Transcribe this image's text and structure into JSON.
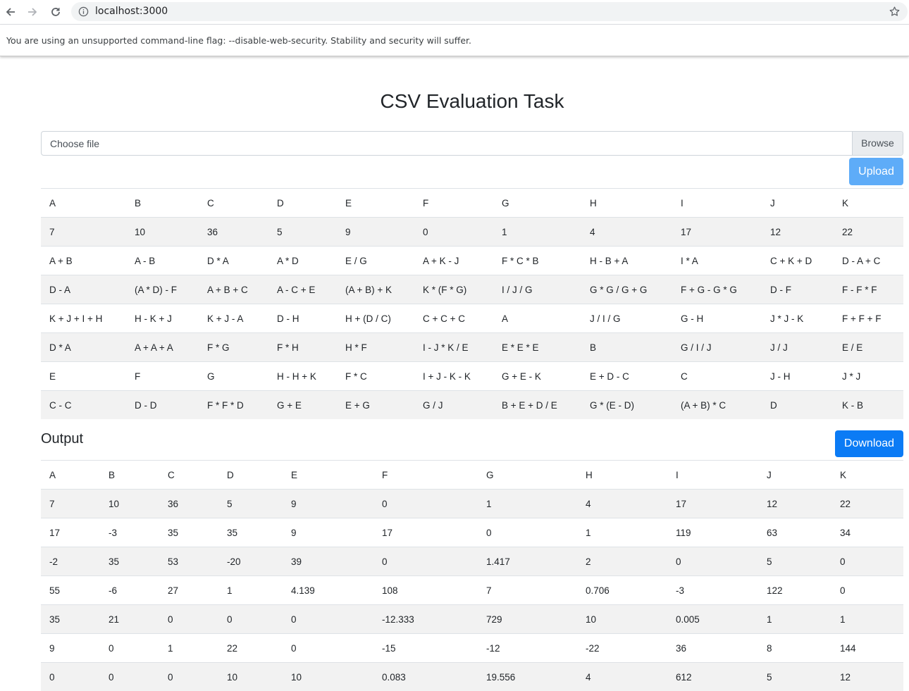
{
  "browser": {
    "url": "localhost:3000",
    "infobar": "You are using an unsupported command-line flag: --disable-web-security. Stability and security will suffer."
  },
  "page": {
    "title": "CSV Evaluation Task",
    "file_placeholder": "Choose file",
    "browse_label": "Browse",
    "upload_label": "Upload",
    "output_title": "Output",
    "download_label": "Download"
  },
  "colors": {
    "upload_button": "#5eacf8",
    "download_button": "#0b7bf5",
    "stripe": "#f2f2f2"
  },
  "input_table": {
    "rows": [
      [
        "A",
        "B",
        "C",
        "D",
        "E",
        "F",
        "G",
        "H",
        "I",
        "J",
        "K"
      ],
      [
        "7",
        "10",
        "36",
        "5",
        "9",
        "0",
        "1",
        "4",
        "17",
        "12",
        "22"
      ],
      [
        "A + B",
        "A - B",
        "D * A",
        "A * D",
        "E / G",
        "A + K - J",
        "F * C * B",
        "H - B + A",
        "I * A",
        "C + K + D",
        "D - A + C"
      ],
      [
        "D - A",
        "(A * D) - F",
        "A + B + C",
        "A - C + E",
        "(A + B) + K",
        "K * (F * G)",
        "I / J / G",
        "G * G / G + G",
        "F + G - G * G",
        "D - F",
        "F - F * F"
      ],
      [
        "K + J + I + H",
        "H - K + J",
        "K + J - A",
        "D - H",
        "H + (D / C)",
        "C + C + C",
        "A",
        "J / I / G",
        "G - H",
        "J * J - K",
        "F + F + F"
      ],
      [
        "D * A",
        "A + A + A",
        "F * G",
        "F * H",
        "H * F",
        "I - J * K / E",
        "E * E * E",
        "B",
        "G / I / J",
        "J / J",
        "E / E"
      ],
      [
        "E",
        "F",
        "G",
        "H - H + K",
        "F * C",
        "I + J - K - K",
        "G + E - K",
        "E + D - C",
        "C",
        "J - H",
        "J * J"
      ],
      [
        "C - C",
        "D - D",
        "F * F * D",
        "G + E",
        "E + G",
        "G / J",
        "B + E + D / E",
        "G * (E - D)",
        "(A + B) * C",
        "D",
        "K - B"
      ]
    ]
  },
  "output_table": {
    "rows": [
      [
        "A",
        "B",
        "C",
        "D",
        "E",
        "F",
        "G",
        "H",
        "I",
        "J",
        "K"
      ],
      [
        "7",
        "10",
        "36",
        "5",
        "9",
        "0",
        "1",
        "4",
        "17",
        "12",
        "22"
      ],
      [
        "17",
        "-3",
        "35",
        "35",
        "9",
        "17",
        "0",
        "1",
        "119",
        "63",
        "34"
      ],
      [
        "-2",
        "35",
        "53",
        "-20",
        "39",
        "0",
        "1.417",
        "2",
        "0",
        "5",
        "0"
      ],
      [
        "55",
        "-6",
        "27",
        "1",
        "4.139",
        "108",
        "7",
        "0.706",
        "-3",
        "122",
        "0"
      ],
      [
        "35",
        "21",
        "0",
        "0",
        "0",
        "-12.333",
        "729",
        "10",
        "0.005",
        "1",
        "1"
      ],
      [
        "9",
        "0",
        "1",
        "22",
        "0",
        "-15",
        "-12",
        "-22",
        "36",
        "8",
        "144"
      ],
      [
        "0",
        "0",
        "0",
        "10",
        "10",
        "0.083",
        "19.556",
        "4",
        "612",
        "5",
        "12"
      ]
    ]
  }
}
